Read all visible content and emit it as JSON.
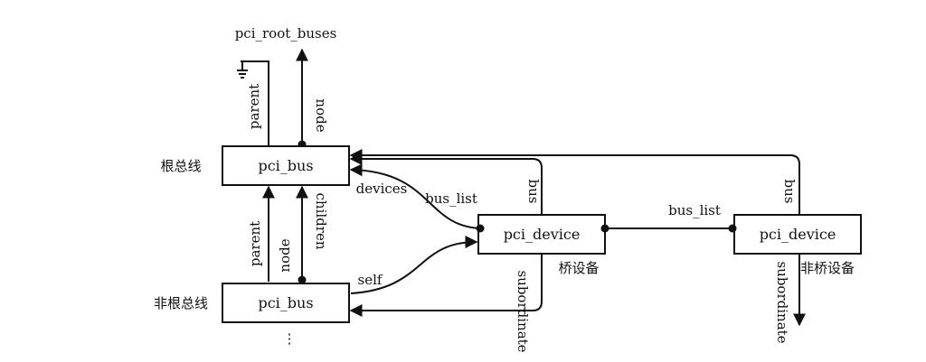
{
  "root_buses_label": "pci_root_buses",
  "root_bus": {
    "side_label": "根总线",
    "box_label": "pci_bus"
  },
  "child_bus": {
    "side_label": "非根总线",
    "box_label": "pci_bus"
  },
  "bridge_device": {
    "box_label": "pci_device",
    "tag": "桥设备"
  },
  "normal_device": {
    "box_label": "pci_device",
    "tag": "非桥设备"
  },
  "edges": {
    "parent": "parent",
    "node": "node",
    "children": "children",
    "devices": "devices",
    "bus_list": "bus_list",
    "bus": "bus",
    "self": "self",
    "subordinate": "subordinate",
    "ellipsis": "⋮"
  },
  "colors": {
    "ink": "#111111",
    "background": "#ffffff"
  }
}
